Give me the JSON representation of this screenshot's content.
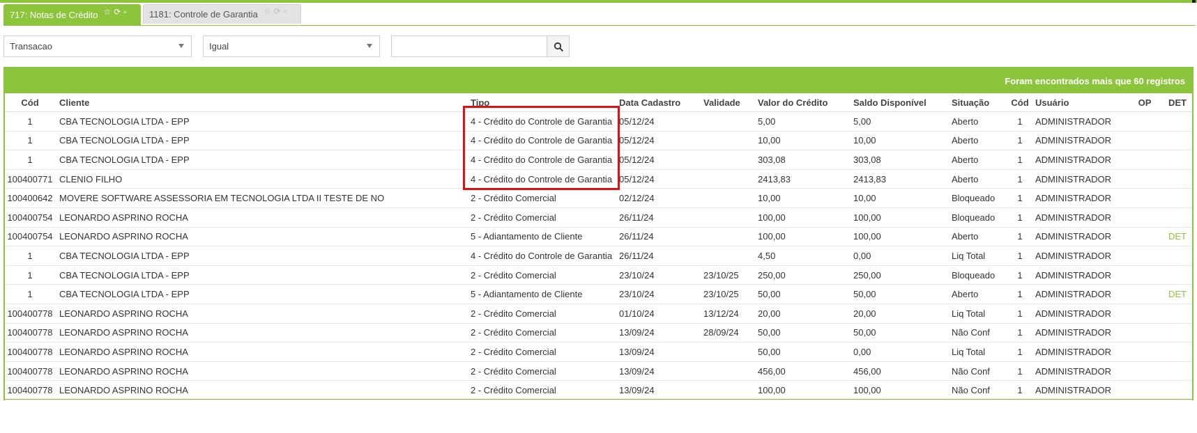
{
  "tabs": [
    {
      "label": "717: Notas de Crédito",
      "active": true
    },
    {
      "label": "1181: Controle de Garantia",
      "active": false
    }
  ],
  "icons": {
    "favorite": "star-icon",
    "refresh": "refresh-icon",
    "close": "square-icon",
    "search": "search-icon"
  },
  "filters": {
    "field": "Transacao",
    "operator": "Igual",
    "value": ""
  },
  "grid": {
    "banner": "Foram encontrados mais que 60 registros",
    "columns": [
      "Cód",
      "Cliente",
      "Tipo",
      "Data Cadastro",
      "Validade",
      "Valor do Crédito",
      "Saldo Disponível",
      "Situação",
      "Cód",
      "Usuário",
      "OP",
      "DET"
    ],
    "rows": [
      [
        "1",
        "CBA TECNOLOGIA LTDA - EPP",
        "4 - Crédito do Controle de Garantia",
        "05/12/24",
        "",
        "5,00",
        "5,00",
        "Aberto",
        "1",
        "ADMINISTRADOR",
        "",
        ""
      ],
      [
        "1",
        "CBA TECNOLOGIA LTDA - EPP",
        "4 - Crédito do Controle de Garantia",
        "05/12/24",
        "",
        "10,00",
        "10,00",
        "Aberto",
        "1",
        "ADMINISTRADOR",
        "",
        ""
      ],
      [
        "1",
        "CBA TECNOLOGIA LTDA - EPP",
        "4 - Crédito do Controle de Garantia",
        "05/12/24",
        "",
        "303,08",
        "303,08",
        "Aberto",
        "1",
        "ADMINISTRADOR",
        "",
        ""
      ],
      [
        "100400771",
        "CLENIO FILHO",
        "4 - Crédito do Controle de Garantia",
        "05/12/24",
        "",
        "2413,83",
        "2413,83",
        "Aberto",
        "1",
        "ADMINISTRADOR",
        "",
        ""
      ],
      [
        "100400642",
        "MOVERE SOFTWARE ASSESSORIA EM TECNOLOGIA LTDA II TESTE DE NO",
        "2 - Crédito Comercial",
        "02/12/24",
        "",
        "10,00",
        "10,00",
        "Bloqueado",
        "1",
        "ADMINISTRADOR",
        "",
        ""
      ],
      [
        "100400754",
        "LEONARDO ASPRINO ROCHA",
        "2 - Crédito Comercial",
        "26/11/24",
        "",
        "100,00",
        "100,00",
        "Bloqueado",
        "1",
        "ADMINISTRADOR",
        "",
        ""
      ],
      [
        "100400754",
        "LEONARDO ASPRINO ROCHA",
        "5 - Adiantamento de Cliente",
        "26/11/24",
        "",
        "100,00",
        "100,00",
        "Aberto",
        "1",
        "ADMINISTRADOR",
        "",
        "DET"
      ],
      [
        "1",
        "CBA TECNOLOGIA LTDA - EPP",
        "4 - Crédito do Controle de Garantia",
        "26/11/24",
        "",
        "4,50",
        "0,00",
        "Liq Total",
        "1",
        "ADMINISTRADOR",
        "",
        ""
      ],
      [
        "1",
        "CBA TECNOLOGIA LTDA - EPP",
        "2 - Crédito Comercial",
        "23/10/24",
        "23/10/25",
        "250,00",
        "250,00",
        "Bloqueado",
        "1",
        "ADMINISTRADOR",
        "",
        ""
      ],
      [
        "1",
        "CBA TECNOLOGIA LTDA - EPP",
        "5 - Adiantamento de Cliente",
        "23/10/24",
        "23/10/25",
        "50,00",
        "50,00",
        "Aberto",
        "1",
        "ADMINISTRADOR",
        "",
        "DET"
      ],
      [
        "100400778",
        "LEONARDO ASPRINO ROCHA",
        "2 - Crédito Comercial",
        "01/10/24",
        "13/12/24",
        "20,00",
        "20,00",
        "Liq Total",
        "1",
        "ADMINISTRADOR",
        "",
        ""
      ],
      [
        "100400778",
        "LEONARDO ASPRINO ROCHA",
        "2 - Crédito Comercial",
        "13/09/24",
        "28/09/24",
        "50,00",
        "50,00",
        "Não Conf",
        "1",
        "ADMINISTRADOR",
        "",
        ""
      ],
      [
        "100400778",
        "LEONARDO ASPRINO ROCHA",
        "2 - Crédito Comercial",
        "13/09/24",
        "",
        "50,00",
        "0,00",
        "Liq Total",
        "1",
        "ADMINISTRADOR",
        "",
        ""
      ],
      [
        "100400778",
        "LEONARDO ASPRINO ROCHA",
        "2 - Crédito Comercial",
        "13/09/24",
        "",
        "456,00",
        "456,00",
        "Não Conf",
        "1",
        "ADMINISTRADOR",
        "",
        ""
      ],
      [
        "100400778",
        "LEONARDO ASPRINO ROCHA",
        "2 - Crédito Comercial",
        "13/09/24",
        "",
        "100,00",
        "100,00",
        "Não Conf",
        "1",
        "ADMINISTRADOR",
        "",
        ""
      ]
    ]
  },
  "colors": {
    "accent": "#8cc43c",
    "highlight": "#e01010"
  }
}
